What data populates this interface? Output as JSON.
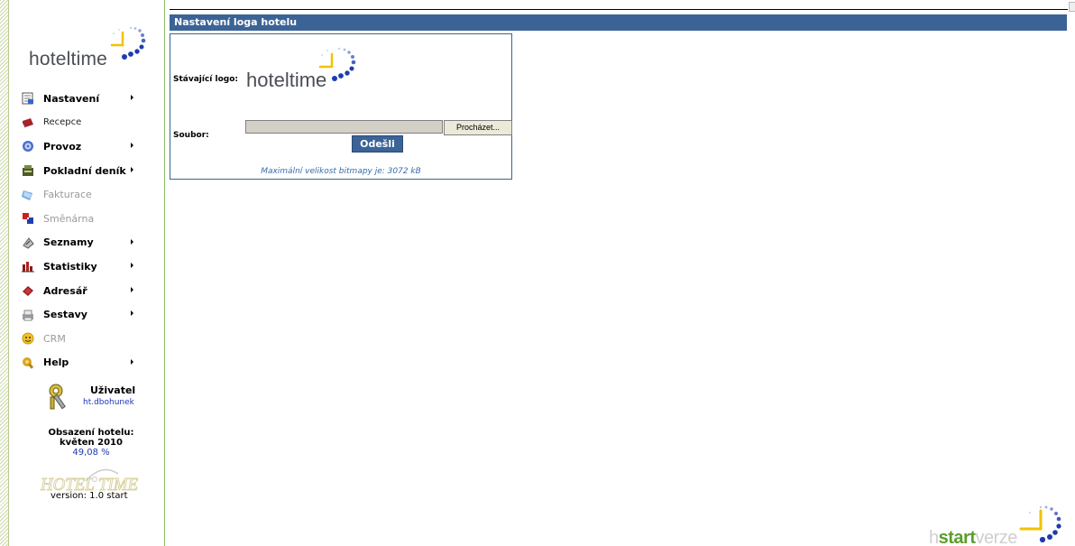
{
  "brand": {
    "logo_text": "hoteltime",
    "footer_logo_text": "HOTEL TIME",
    "start_logo": {
      "prefix": "h",
      "start": "start",
      "verze": "verze"
    },
    "colors": {
      "title_bar": "#3b6396",
      "clock_hand": "#f2c200",
      "dots": "#1e3bb0",
      "start_green": "#5a9e2c"
    }
  },
  "sidebar": {
    "items": [
      {
        "label": "Nastavení",
        "icon": "settings-doc-icon",
        "style": "bold",
        "submenu": true
      },
      {
        "label": "Recepce",
        "icon": "reception-book-icon",
        "style": "normal",
        "submenu": false
      },
      {
        "label": "Provoz",
        "icon": "gear-icon",
        "style": "bold",
        "submenu": true
      },
      {
        "label": "Pokladní deník",
        "icon": "cash-register-icon",
        "style": "bold",
        "submenu": true
      },
      {
        "label": "Fakturace",
        "icon": "invoice-icon",
        "style": "dim",
        "submenu": false
      },
      {
        "label": "Směnárna",
        "icon": "exchange-flag-icon",
        "style": "dim",
        "submenu": false
      },
      {
        "label": "Seznamy",
        "icon": "list-icon",
        "style": "bold",
        "submenu": true
      },
      {
        "label": "Statistiky",
        "icon": "bar-chart-icon",
        "style": "bold",
        "submenu": true
      },
      {
        "label": "Adresář",
        "icon": "address-book-icon",
        "style": "bold",
        "submenu": true
      },
      {
        "label": "Sestavy",
        "icon": "printer-icon",
        "style": "bold",
        "submenu": true
      },
      {
        "label": "CRM",
        "icon": "crm-smiley-icon",
        "style": "dim",
        "submenu": false
      },
      {
        "label": "Help",
        "icon": "help-icon",
        "style": "bold",
        "submenu": true
      }
    ],
    "user": {
      "title": "Uživatel",
      "name": "ht.dbohunek",
      "icon": "keys-icon"
    },
    "occupancy": {
      "title": "Obsazení hotelu:",
      "period": "květen 2010",
      "value": "49,08 %"
    },
    "version": "version: 1.0 start"
  },
  "main": {
    "title": "Nastavení loga hotelu",
    "current_logo_label": "Stávající logo:",
    "file_label": "Soubor:",
    "file_input_value": "",
    "browse_label": "Procházet...",
    "submit_label": "Odešli",
    "max_size_note": "Maximální velikost bitmapy je: 3072 kB"
  }
}
